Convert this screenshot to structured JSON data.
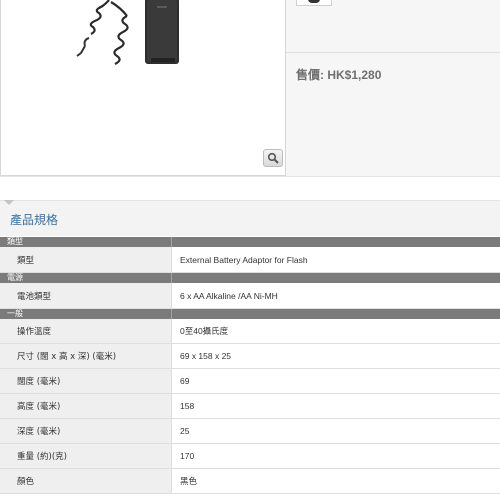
{
  "product": {
    "price_text": "售價: HK$1,280",
    "image_icon": "battery-pack-photo",
    "zoom_icon": "magnifier-icon"
  },
  "specs": {
    "title": "產品規格",
    "sections": [
      {
        "name": "類型",
        "rows": [
          {
            "label": "類型",
            "value": "External Battery Adaptor for Flash"
          }
        ]
      },
      {
        "name": "電源",
        "rows": [
          {
            "label": "電池類型",
            "value": "6 x AA Alkaline /AA Ni-MH"
          }
        ]
      },
      {
        "name": "一般",
        "rows": [
          {
            "label": "操作溫度",
            "value": "0至40攝氏度"
          },
          {
            "label": "尺寸 (闊 x 高 x 深) (毫米)",
            "value": "69 x 158 x 25"
          },
          {
            "label": "闊度 (毫米)",
            "value": "69"
          },
          {
            "label": "高度 (毫米)",
            "value": "158"
          },
          {
            "label": "深度 (毫米)",
            "value": "25"
          },
          {
            "label": "重量 (約)(克)",
            "value": "170"
          },
          {
            "label": "顏色",
            "value": "黑色"
          }
        ]
      }
    ]
  },
  "colors": {
    "title_blue": "#3a6f9b",
    "category_bar": "#7b7b7b"
  }
}
